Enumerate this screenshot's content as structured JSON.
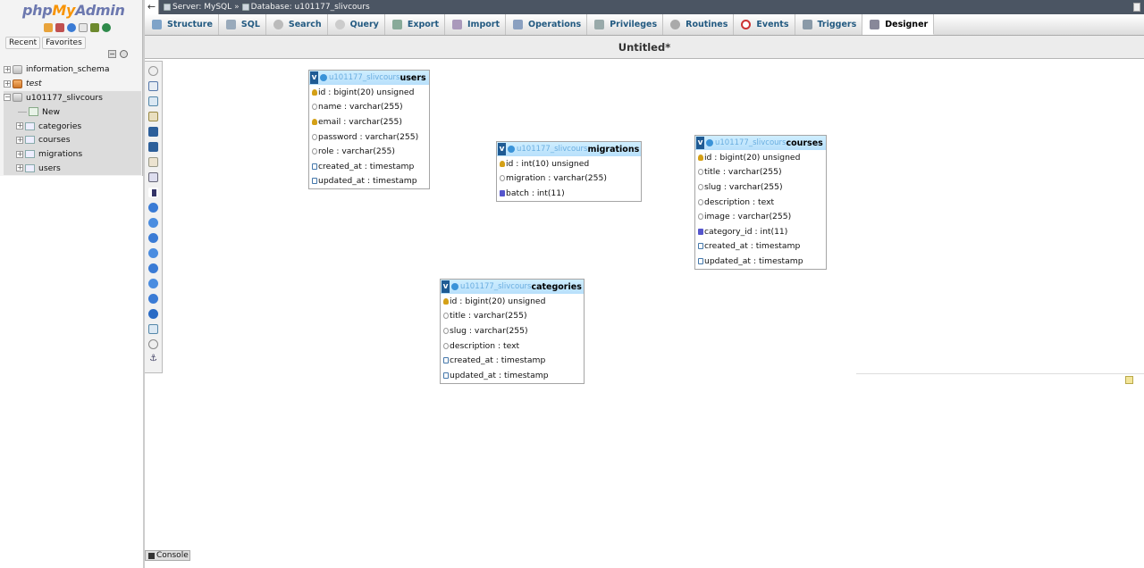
{
  "logo": {
    "php": "php",
    "my": "My",
    "admin": "Admin"
  },
  "nav": {
    "tabs": [
      "Recent",
      "Favorites"
    ],
    "tree": {
      "db1": "information_schema",
      "db2": "test",
      "db3": "u101177_slivcours",
      "new": "New",
      "tables": [
        "categories",
        "courses",
        "migrations",
        "users"
      ]
    }
  },
  "breadcrumb": {
    "server": "Server: MySQL",
    "database": "Database: u101177_slivcours"
  },
  "menu": {
    "tabs": [
      "Structure",
      "SQL",
      "Search",
      "Query",
      "Export",
      "Import",
      "Operations",
      "Privileges",
      "Routines",
      "Events",
      "Triggers",
      "Designer"
    ],
    "active": "Designer"
  },
  "page_title": "Untitled*",
  "designer": {
    "db_prefix": "u101177_slivcours",
    "tables": {
      "users": {
        "name": "users",
        "columns": [
          "id : bigint(20) unsigned",
          "name : varchar(255)",
          "email : varchar(255)",
          "password : varchar(255)",
          "role : varchar(255)",
          "created_at : timestamp",
          "updated_at : timestamp"
        ]
      },
      "migrations": {
        "name": "migrations",
        "columns": [
          "id : int(10) unsigned",
          "migration : varchar(255)",
          "batch : int(11)"
        ]
      },
      "courses": {
        "name": "courses",
        "columns": [
          "id : bigint(20) unsigned",
          "title : varchar(255)",
          "slug : varchar(255)",
          "description : text",
          "image : varchar(255)",
          "category_id : int(11)",
          "created_at : timestamp",
          "updated_at : timestamp"
        ]
      },
      "categories": {
        "name": "categories",
        "columns": [
          "id : bigint(20) unsigned",
          "title : varchar(255)",
          "slug : varchar(255)",
          "description : text",
          "created_at : timestamp",
          "updated_at : timestamp"
        ]
      }
    }
  },
  "console": {
    "label": "Console"
  },
  "colors": {
    "topbar": "#4b5563",
    "tab_text": "#235a81",
    "table_header": "#b8e0fb",
    "logo_my": "#f89406",
    "logo_php": "#6c78af"
  }
}
